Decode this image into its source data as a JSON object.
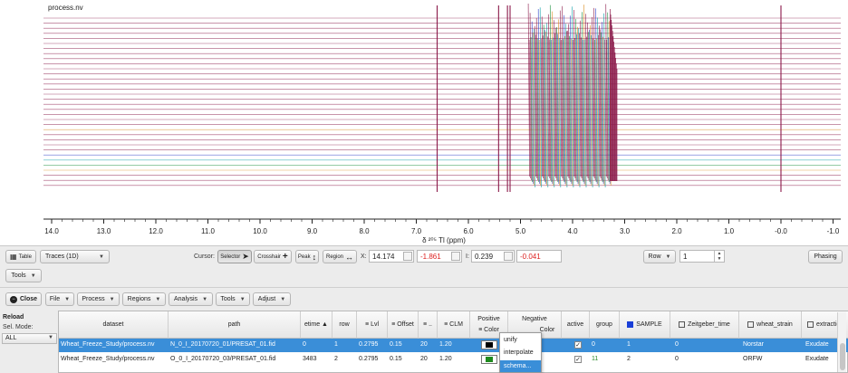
{
  "plot": {
    "title": "process.nv",
    "xlabel": "δ ²⁰⁵ Tl (ppm)",
    "ticks": [
      "14.0",
      "13.0",
      "12.0",
      "11.0",
      "10.0",
      "9.0",
      "8.0",
      "7.0",
      "6.0",
      "5.0",
      "4.0",
      "3.0",
      "2.0",
      "1.0",
      "-0.0",
      "-1.0"
    ],
    "colors": {
      "trace": "#8b1a4a",
      "accent1": "#1a8f3c",
      "accent2": "#2b3fc9",
      "accent3": "#d98a1c",
      "accent4": "#0ea0a8"
    }
  },
  "toolbar": {
    "table_button": "Table",
    "trace_select": "Traces (1D)",
    "cursor_label": "Cursor:",
    "cursor_selector": "Selector",
    "cursor_crosshair": "Crosshair",
    "cursor_peak": "Peak",
    "cursor_region": "Region",
    "x_label": "X:",
    "x_value": "14.174",
    "x_delta": "-1.861",
    "i_label": "I:",
    "i_value": "0.239",
    "i_delta": "-0.041",
    "row_select": "Row",
    "row_value": "1",
    "phasing_button": "Phasing"
  },
  "tools_bar": {
    "tools_button": "Tools"
  },
  "menu_bar": {
    "close_button": "Close",
    "items": [
      "File",
      "Process",
      "Regions",
      "Analysis",
      "Tools",
      "Adjust"
    ]
  },
  "left": {
    "reload": "Reload",
    "sel_mode_label": "Sel. Mode:",
    "sel_mode_value": "ALL"
  },
  "table": {
    "headers": {
      "dataset": "dataset",
      "path": "path",
      "etime": "etime ▲",
      "row": "row",
      "lvl": "Lvl",
      "offset": "Offset",
      "dots": "..",
      "clm": "CLM",
      "positive": "Positive",
      "positive_sub": "Color",
      "negative": "Negative",
      "negative_sub": "Color",
      "active": "active",
      "group": "group",
      "sample": "SAMPLE",
      "zeitgeber": "Zeitgeber_time",
      "wheat": "wheat_strain",
      "extraction": "extraction"
    },
    "rows": [
      {
        "dataset": "Wheat_Freeze_Study/process.nv",
        "path": "N_0_I_20170720_01/PRESAT_01.fid",
        "etime": "0",
        "row": "1",
        "lvl": "0.2795",
        "offset": "0.15",
        "dots": "20",
        "clm": "1.20",
        "pos_color": "#000000",
        "active": "✓",
        "group": "0",
        "sample": "1",
        "zeitgeber": "0",
        "wheat": "Norstar",
        "extraction": "Exudate"
      },
      {
        "dataset": "Wheat_Freeze_Study/process.nv",
        "path": "O_0_I_20170720_03/PRESAT_01.fid",
        "etime": "3483",
        "row": "2",
        "lvl": "0.2795",
        "offset": "0.15",
        "dots": "20",
        "clm": "1.20",
        "pos_color": "#1e8a1e",
        "active": "✓",
        "group": "11",
        "sample": "2",
        "zeitgeber": "0",
        "wheat": "ORFW",
        "extraction": "Exudate"
      }
    ]
  },
  "popup": {
    "items": [
      "unify",
      "interpolate",
      "schema..."
    ]
  },
  "colors": {
    "selection": "#3a8ed8",
    "sample_header": "#1a3fd8"
  }
}
